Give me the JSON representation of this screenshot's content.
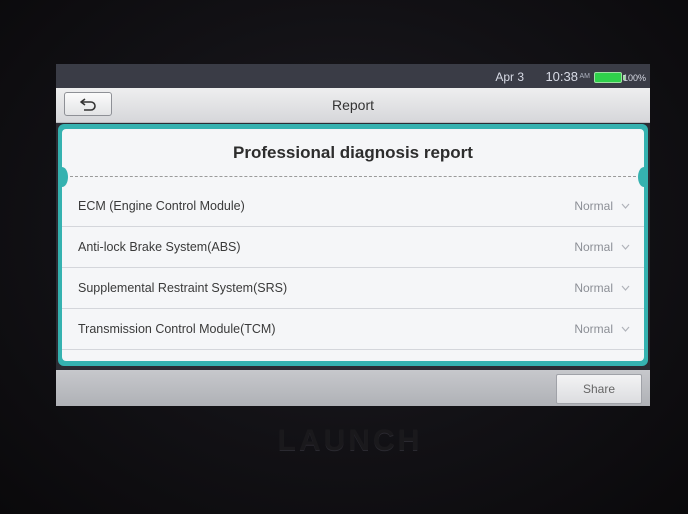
{
  "status_bar": {
    "date": "Apr 3",
    "time": "10:38",
    "ampm": "AM",
    "battery_pct": "100%"
  },
  "header": {
    "title": "Report",
    "back_icon": "back-arrow-icon"
  },
  "report": {
    "title": "Professional diagnosis report",
    "rows": [
      {
        "label": "ECM (Engine Control Module)",
        "status": "Normal"
      },
      {
        "label": "Anti-lock Brake System(ABS)",
        "status": "Normal"
      },
      {
        "label": "Supplemental Restraint System(SRS)",
        "status": "Normal"
      },
      {
        "label": "Transmission Control Module(TCM)",
        "status": "Normal"
      }
    ]
  },
  "footer": {
    "share_label": "Share"
  },
  "device": {
    "brand": "LAUNCH"
  },
  "colors": {
    "accent_teal": "#35b2b0",
    "battery_green": "#2fd14b"
  }
}
